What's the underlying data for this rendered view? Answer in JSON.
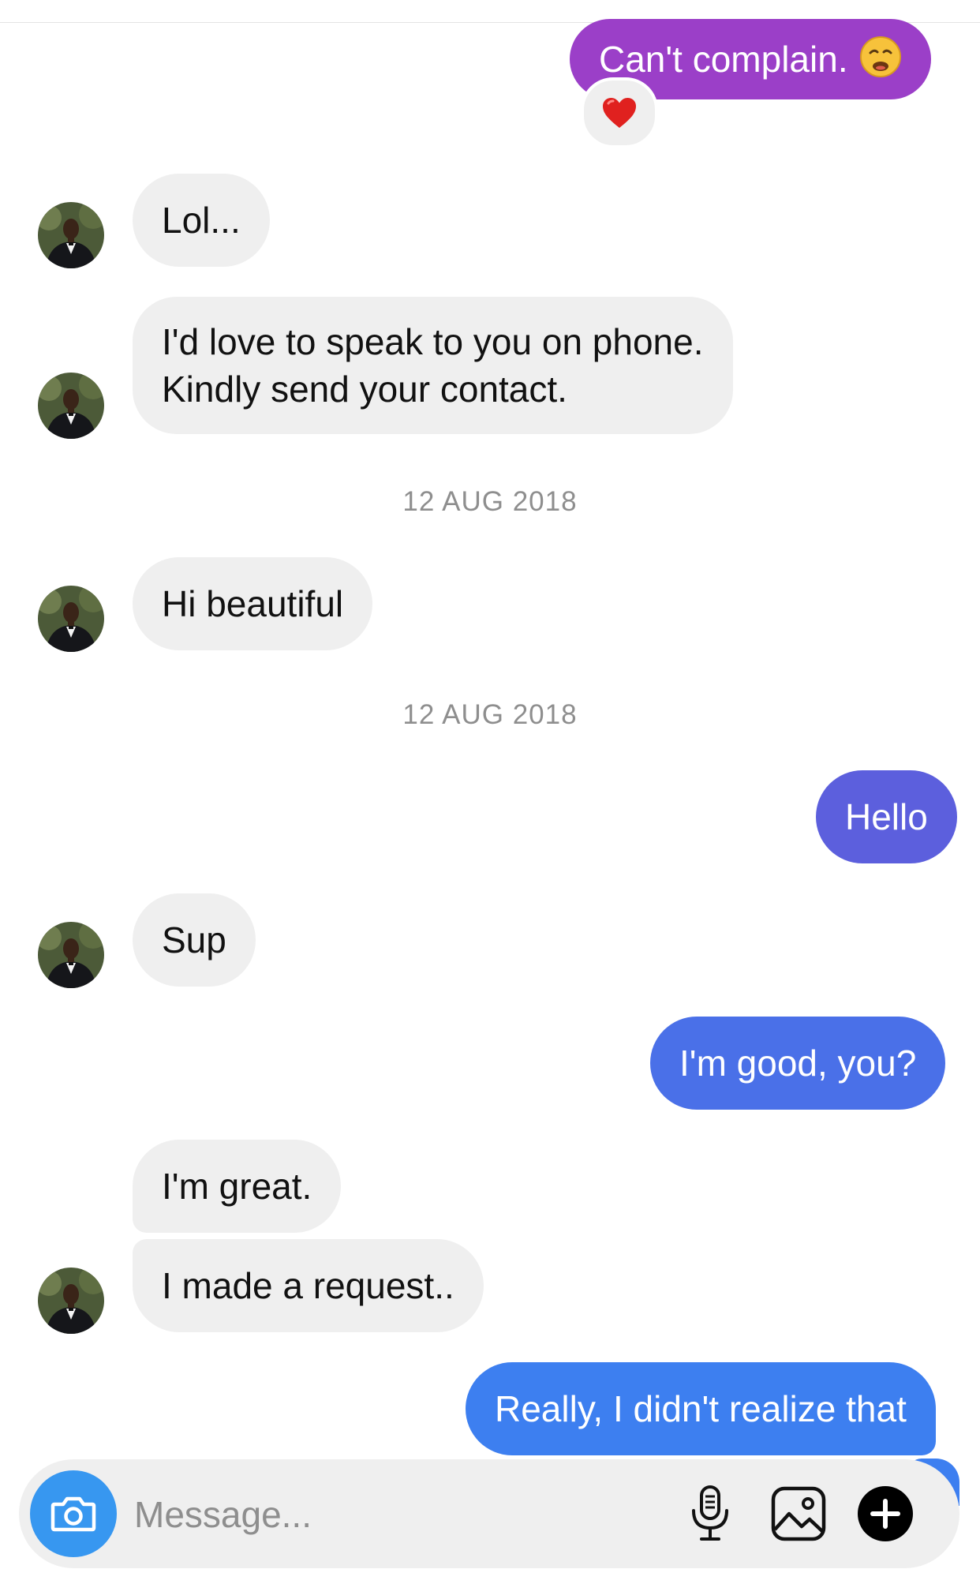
{
  "messages": [
    {
      "sender": "me",
      "text": "Can't complain.",
      "emoji": "weary-face",
      "reaction": "heart"
    },
    {
      "sender": "them",
      "text": "Lol..."
    },
    {
      "sender": "them",
      "lines": [
        "I'd love to speak to you on phone.",
        "Kindly send your contact."
      ]
    },
    {
      "type": "date",
      "text": "12 AUG 2018"
    },
    {
      "sender": "them",
      "text": "Hi beautiful"
    },
    {
      "type": "date",
      "text": "12 AUG 2018"
    },
    {
      "sender": "me",
      "text": "Hello"
    },
    {
      "sender": "them",
      "text": "Sup"
    },
    {
      "sender": "me",
      "text": "I'm good, you?"
    },
    {
      "sender": "them",
      "text": "I'm great."
    },
    {
      "sender": "them",
      "text": "I made a request.."
    },
    {
      "sender": "me",
      "text": "Really, I didn't realize that"
    }
  ],
  "composer": {
    "placeholder": "Message...",
    "icons": [
      "camera-icon",
      "microphone-icon",
      "gallery-icon",
      "plus-icon"
    ]
  },
  "colors": {
    "incoming_bubble": "#efefef",
    "outgoing_purple": "#9b3fc8",
    "outgoing_indigo": "#5c5fdd",
    "outgoing_blue": "#4a70e8",
    "outgoing_blue_light": "#3d7ff0",
    "camera_button": "#3797f0",
    "date_text": "#8e8e8e"
  }
}
